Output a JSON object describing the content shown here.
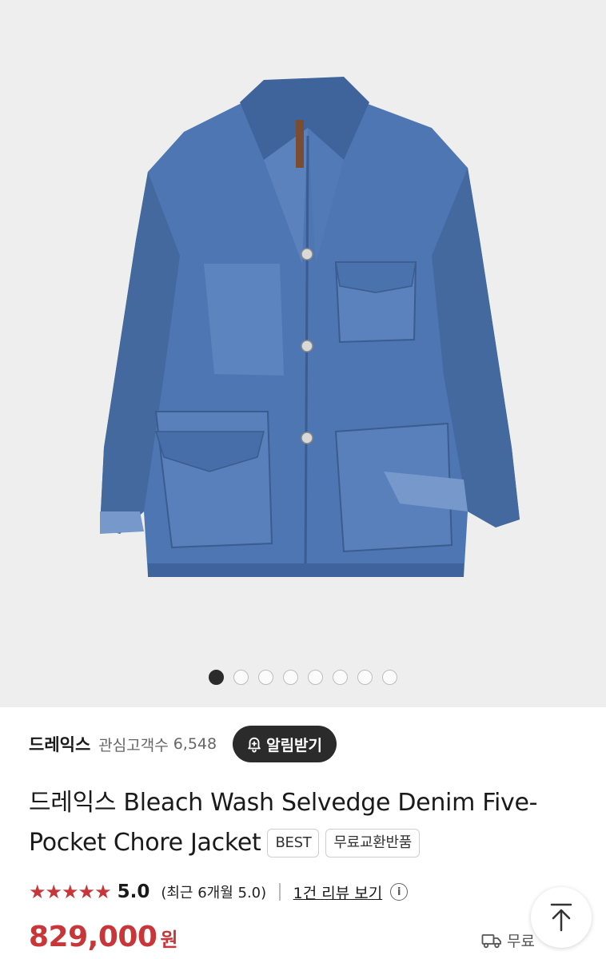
{
  "gallery": {
    "image_alt": "drakes-denim-chore-jacket",
    "total_images": 8,
    "current_index": 1
  },
  "brand": {
    "name": "드레익스",
    "fans_label": "관심고객수",
    "fans_count": "6,548",
    "alarm_button": "알림받기"
  },
  "product": {
    "title_line1": "드레익스 Bleach Wash Selvedge Denim Five-",
    "title_line2": "Pocket Chore Jacket",
    "tags": [
      "BEST",
      "무료교환반품"
    ]
  },
  "rating": {
    "stars": "★★★★★",
    "score": "5.0",
    "recent": "(최근 6개월 5.0)",
    "review_link": "1건 리뷰 보기",
    "info_icon": "i"
  },
  "price": {
    "amount": "829,000",
    "currency": "원"
  },
  "shipping": {
    "label": "무료"
  },
  "colors": {
    "accent_red": "#c8363a",
    "dark_button": "#2b2b2b",
    "denim": "#4d76b3"
  }
}
